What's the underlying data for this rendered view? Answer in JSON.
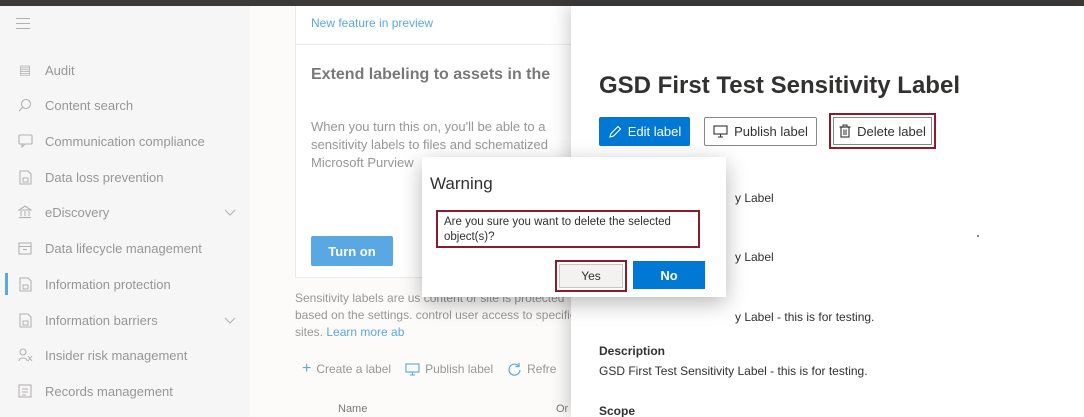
{
  "sidebar": {
    "items": [
      {
        "label": "Audit",
        "icon": "audit-icon",
        "glyph": "▤"
      },
      {
        "label": "Content search",
        "icon": "search-icon",
        "glyph": "⚲"
      },
      {
        "label": "Communication compliance",
        "icon": "chat-icon",
        "glyph": "☐"
      },
      {
        "label": "Data loss prevention",
        "icon": "shield-icon",
        "glyph": "◫"
      },
      {
        "label": "eDiscovery",
        "icon": "ediscovery-icon",
        "glyph": "⚖"
      },
      {
        "label": "Data lifecycle management",
        "icon": "lifecycle-icon",
        "glyph": "☰"
      },
      {
        "label": "Information protection",
        "icon": "info-protection-icon",
        "glyph": "◫"
      },
      {
        "label": "Information barriers",
        "icon": "barrier-icon",
        "glyph": "◫"
      },
      {
        "label": "Insider risk management",
        "icon": "insider-risk-icon",
        "glyph": "⚇"
      },
      {
        "label": "Records management",
        "icon": "records-icon",
        "glyph": "▦"
      }
    ]
  },
  "main": {
    "preview_tag": "New feature in preview",
    "preview_title": "Extend labeling to assets in the",
    "preview_text": "When you turn this on, you'll be able to a sensitivity labels to files and schematized Microsoft Purview",
    "turn_on_label": "Turn on",
    "desc_text": "Sensitivity labels are us content or site is protected based on the settings. control user access to specific sites.",
    "desc_link": "Learn more ab",
    "toolbar": {
      "create_label": "Create a label",
      "publish_label": "Publish label",
      "refresh_label": "Refre"
    },
    "columns": {
      "name": "Name",
      "order": "Or"
    }
  },
  "panel": {
    "title": "GSD First Test Sensitivity Label",
    "edit_label": "Edit label",
    "publish_label": "Publish label",
    "delete_label": "Delete label",
    "frag1": "y Label",
    "frag2": "y Label",
    "frag3": "y Label - this is for testing.",
    "description_label": "Description",
    "description_value": "GSD First Test Sensitivity Label - this is for testing.",
    "scope_label": "Scope"
  },
  "dialog": {
    "title": "Warning",
    "message": "Are you sure you want to delete the selected object(s)?",
    "yes_label": "Yes",
    "no_label": "No"
  },
  "colors": {
    "accent": "#0078d4",
    "highlight_border": "#8b1c2e"
  }
}
